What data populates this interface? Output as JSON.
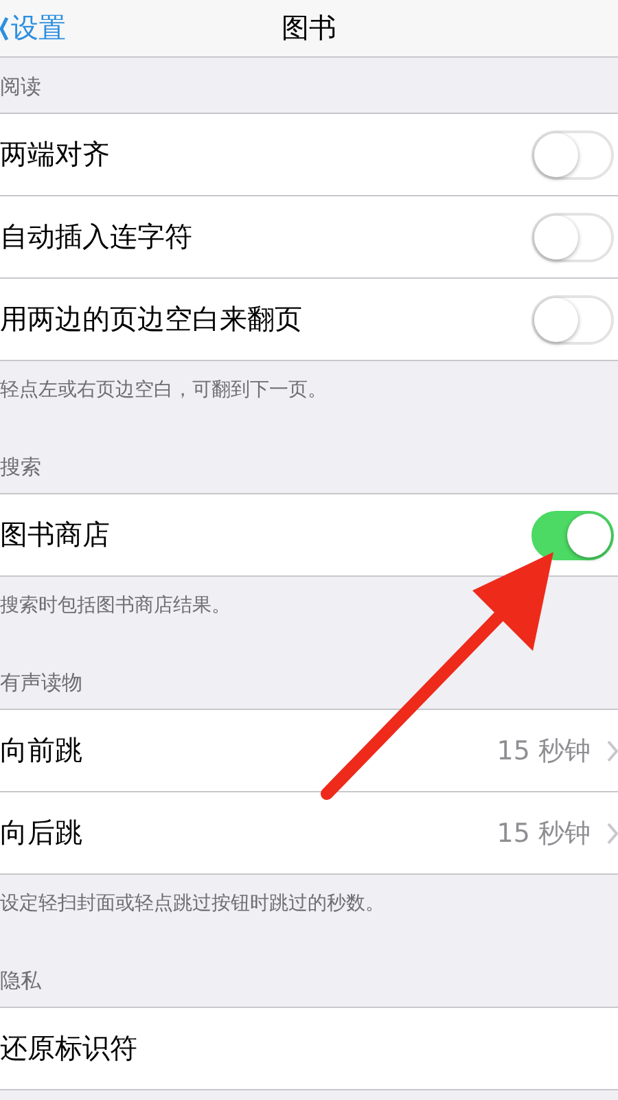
{
  "nav": {
    "back": "设置",
    "title": "图书"
  },
  "sections": [
    {
      "header": "阅读",
      "rows": [
        {
          "kind": "toggle",
          "label": "两端对齐",
          "on": false
        },
        {
          "kind": "toggle",
          "label": "自动插入连字符",
          "on": false
        },
        {
          "kind": "toggle",
          "label": "用两边的页边空白来翻页",
          "on": false
        }
      ],
      "footer": "轻点左或右页边空白，可翻到下一页。"
    },
    {
      "header": "搜索",
      "rows": [
        {
          "kind": "toggle",
          "label": "图书商店",
          "on": true
        }
      ],
      "footer": "搜索时包括图书商店结果。"
    },
    {
      "header": "有声读物",
      "rows": [
        {
          "kind": "value",
          "label": "向前跳",
          "value": "15 秒钟"
        },
        {
          "kind": "value",
          "label": "向后跳",
          "value": "15 秒钟"
        }
      ],
      "footer": "设定轻扫封面或轻点跳过按钮时跳过的秒数。"
    },
    {
      "header": "隐私",
      "rows": [
        {
          "kind": "plain",
          "label": "还原标识符"
        }
      ]
    }
  ]
}
